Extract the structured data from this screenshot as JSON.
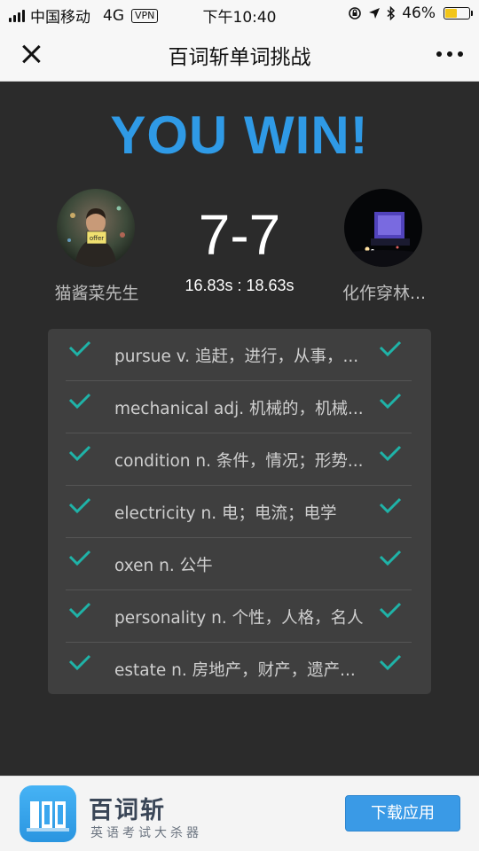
{
  "status_bar": {
    "carrier": "中国移动",
    "network": "4G",
    "vpn": "VPN",
    "time": "下午10:40",
    "battery_percent": "46%",
    "battery_level": 0.46
  },
  "nav": {
    "title": "百词斩单词挑战"
  },
  "result": {
    "headline": "YOU WIN!",
    "score": "7-7",
    "times": "16.83s : 18.63s",
    "player_left": "猫酱菜先生",
    "player_right": "化作穿林..."
  },
  "words": [
    {
      "text": "pursue v. 追赶，进行，从事，...",
      "left_correct": true,
      "right_correct": true
    },
    {
      "text": "mechanical adj. 机械的，机械...",
      "left_correct": true,
      "right_correct": true
    },
    {
      "text": "condition n. 条件，情况；形势...",
      "left_correct": true,
      "right_correct": true
    },
    {
      "text": "electricity n. 电；电流；电学",
      "left_correct": true,
      "right_correct": true
    },
    {
      "text": "oxen n. 公牛",
      "left_correct": true,
      "right_correct": true
    },
    {
      "text": "personality n. 个性，人格，名人",
      "left_correct": true,
      "right_correct": true
    },
    {
      "text": "estate n. 房地产，财产，遗产...",
      "left_correct": true,
      "right_correct": true
    }
  ],
  "banner": {
    "app_name": "百词斩",
    "slogan": "英语考试大杀器",
    "download_label": "下载应用"
  },
  "colors": {
    "accent": "#2f9ae6",
    "check": "#1fb3a8",
    "background": "#2b2b2b",
    "panel": "#3f3f3f"
  }
}
